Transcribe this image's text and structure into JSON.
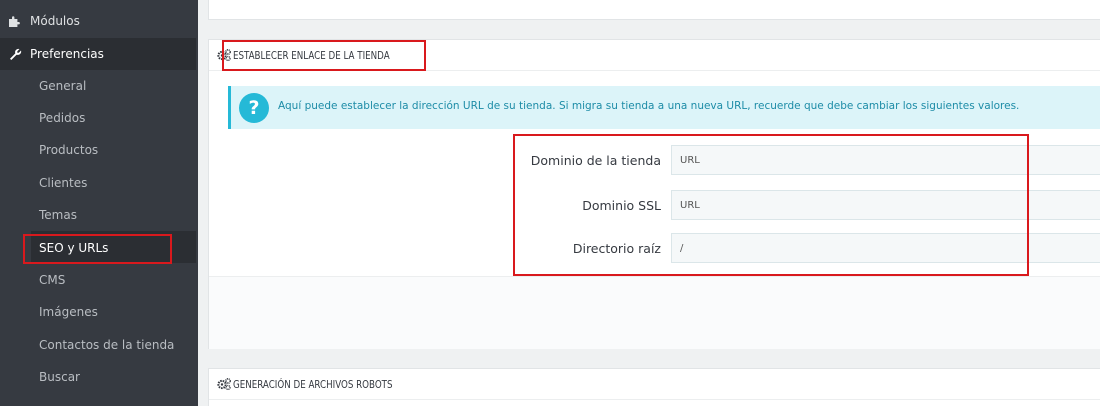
{
  "sidebar": {
    "main_items": [
      {
        "label": "Módulos",
        "icon": "puzzle-icon"
      },
      {
        "label": "Preferencias",
        "icon": "wrench-icon"
      }
    ],
    "sub_items": [
      {
        "label": "General"
      },
      {
        "label": "Pedidos"
      },
      {
        "label": "Productos"
      },
      {
        "label": "Clientes"
      },
      {
        "label": "Temas"
      },
      {
        "label": "SEO y URLs"
      },
      {
        "label": "CMS"
      },
      {
        "label": "Imágenes"
      },
      {
        "label": "Contactos de la tienda"
      },
      {
        "label": "Buscar"
      }
    ]
  },
  "shop_url_panel": {
    "title": "ESTABLECER ENLACE DE LA TIENDA",
    "info": "Aquí puede establecer la dirección URL de su tienda. Si migra su tienda a una nueva URL, recuerde que debe cambiar los siguientes valores.",
    "fields": [
      {
        "label": "Dominio de la tienda",
        "value": "URL"
      },
      {
        "label": "Dominio SSL",
        "value": "URL"
      },
      {
        "label": "Directorio raíz",
        "value": "/"
      }
    ]
  },
  "robots_panel": {
    "title": "GENERACIÓN DE ARCHIVOS ROBOTS"
  },
  "colors": {
    "sidebar_bg": "#363a41",
    "info_accent": "#25b9d7",
    "highlight": "#d9191d"
  }
}
